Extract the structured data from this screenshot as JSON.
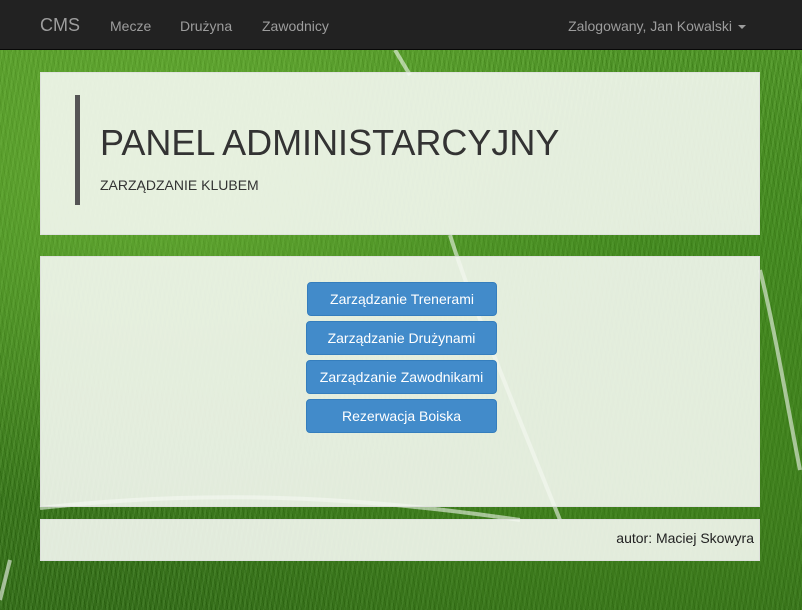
{
  "navbar": {
    "brand": "CMS",
    "links": [
      "Mecze",
      "Drużyna",
      "Zawodnicy"
    ],
    "user_menu": "Zalogowany, Jan Kowalski"
  },
  "header": {
    "title": "PANEL ADMINISTARCYJNY",
    "subtitle": "ZARZĄDZANIE KLUBEM"
  },
  "actions": [
    "Zarządzanie Trenerami",
    "Zarządzanie Drużynami",
    "Zarządzanie Zawodnikami",
    "Rezerwacja Boiska"
  ],
  "footer": {
    "author": "autor: Maciej Skowyra"
  },
  "colors": {
    "navbar": "#222222",
    "nav_text": "#9d9d9d",
    "button": "#428bca",
    "panel": "#f5f8f2",
    "grass": "#3f8a1a"
  }
}
